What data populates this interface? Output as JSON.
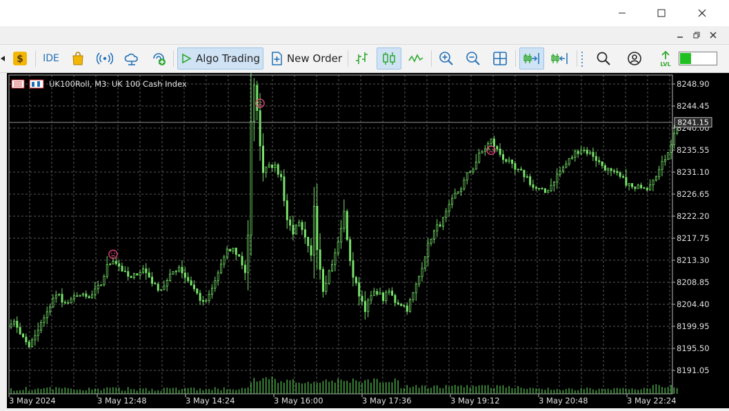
{
  "window": {
    "minimize_icon": "minimize-icon",
    "maximize_icon": "maximize-icon",
    "close_icon": "close-icon"
  },
  "toolbar": {
    "ide_label": "IDE",
    "algo_trading_label": "Algo Trading",
    "new_order_label": "New Order",
    "colors": {
      "active_bg": "#cfe3f5",
      "green": "#2fa82f",
      "blue": "#1f6fb5"
    }
  },
  "chart": {
    "header": "UK100Roll, M3:  UK 100 Cash Index",
    "current_price_label": "8241.15",
    "colors": {
      "background": "#000000",
      "candle": "#78e36b",
      "grid": "#5a5a5a",
      "axis_text": "#e0e0e0",
      "marker": "#e0457b"
    }
  },
  "chart_data": {
    "type": "candlestick",
    "y_ticks": [
      "8248.90",
      "8244.45",
      "8240.00",
      "8235.55",
      "8231.10",
      "8226.65",
      "8222.20",
      "8217.75",
      "8213.30",
      "8208.85",
      "8204.40",
      "8199.95",
      "8195.50",
      "8191.05"
    ],
    "x_ticks": [
      "3 May 2024",
      "3 May 12:48",
      "3 May 14:24",
      "3 May 16:00",
      "3 May 17:36",
      "3 May 19:12",
      "3 May 20:48",
      "3 May 22:24"
    ],
    "ylim": [
      8188.6,
      8251.7
    ],
    "current_price": 8241.15,
    "grid": true,
    "close_path": [
      [
        0,
        8201.0
      ],
      [
        2,
        8200.0
      ],
      [
        4,
        8197.5
      ],
      [
        6,
        8196.0
      ],
      [
        8,
        8197.8
      ],
      [
        10,
        8200.5
      ],
      [
        12,
        8202.5
      ],
      [
        14,
        8205.8
      ],
      [
        16,
        8206.2
      ],
      [
        18,
        8204.5
      ],
      [
        20,
        8205.0
      ],
      [
        22,
        8206.5
      ],
      [
        24,
        8206.0
      ],
      [
        26,
        8205.5
      ],
      [
        28,
        8207.0
      ],
      [
        30,
        8208.5
      ],
      [
        32,
        8212.0
      ],
      [
        34,
        8213.5
      ],
      [
        36,
        8212.2
      ],
      [
        38,
        8210.5
      ],
      [
        40,
        8209.5
      ],
      [
        42,
        8210.8
      ],
      [
        44,
        8211.5
      ],
      [
        46,
        8210.0
      ],
      [
        48,
        8208.0
      ],
      [
        50,
        8207.5
      ],
      [
        52,
        8209.0
      ],
      [
        54,
        8211.0
      ],
      [
        56,
        8212.0
      ],
      [
        58,
        8210.0
      ],
      [
        60,
        8208.5
      ],
      [
        62,
        8206.5
      ],
      [
        64,
        8204.5
      ],
      [
        66,
        8206.0
      ],
      [
        68,
        8209.0
      ],
      [
        70,
        8212.5
      ],
      [
        72,
        8215.0
      ],
      [
        74,
        8215.5
      ],
      [
        76,
        8214.0
      ],
      [
        78,
        8211.0
      ],
      [
        79,
        8218.5
      ],
      [
        80,
        8241.0
      ],
      [
        81,
        8248.2
      ],
      [
        82,
        8244.0
      ],
      [
        83,
        8236.0
      ],
      [
        84,
        8231.5
      ],
      [
        86,
        8233.0
      ],
      [
        88,
        8232.0
      ],
      [
        90,
        8230.0
      ],
      [
        92,
        8221.5
      ],
      [
        94,
        8219.0
      ],
      [
        96,
        8220.5
      ],
      [
        98,
        8217.5
      ],
      [
        100,
        8214.0
      ],
      [
        101,
        8224.5
      ],
      [
        102,
        8216.0
      ],
      [
        104,
        8207.5
      ],
      [
        106,
        8211.0
      ],
      [
        108,
        8214.5
      ],
      [
        110,
        8219.5
      ],
      [
        111,
        8223.5
      ],
      [
        112,
        8217.0
      ],
      [
        114,
        8210.0
      ],
      [
        116,
        8206.5
      ],
      [
        118,
        8203.5
      ],
      [
        120,
        8206.0
      ],
      [
        122,
        8207.0
      ],
      [
        124,
        8205.5
      ],
      [
        126,
        8207.0
      ],
      [
        128,
        8205.0
      ],
      [
        130,
        8204.5
      ],
      [
        132,
        8203.5
      ],
      [
        134,
        8206.5
      ],
      [
        136,
        8210.0
      ],
      [
        138,
        8214.5
      ],
      [
        140,
        8218.0
      ],
      [
        142,
        8220.0
      ],
      [
        144,
        8221.5
      ],
      [
        146,
        8224.0
      ],
      [
        148,
        8226.5
      ],
      [
        150,
        8228.0
      ],
      [
        152,
        8230.5
      ],
      [
        154,
        8232.0
      ],
      [
        156,
        8234.5
      ],
      [
        158,
        8236.0
      ],
      [
        160,
        8237.5
      ],
      [
        162,
        8235.5
      ],
      [
        164,
        8234.0
      ],
      [
        166,
        8233.0
      ],
      [
        168,
        8231.5
      ],
      [
        170,
        8231.0
      ],
      [
        172,
        8230.0
      ],
      [
        174,
        8228.0
      ],
      [
        176,
        8227.5
      ],
      [
        178,
        8227.0
      ],
      [
        180,
        8228.5
      ],
      [
        182,
        8230.5
      ],
      [
        184,
        8232.0
      ],
      [
        186,
        8233.5
      ],
      [
        188,
        8235.0
      ],
      [
        190,
        8235.8
      ],
      [
        192,
        8235.2
      ],
      [
        194,
        8234.5
      ],
      [
        196,
        8233.0
      ],
      [
        198,
        8232.0
      ],
      [
        200,
        8231.0
      ],
      [
        202,
        8230.5
      ],
      [
        204,
        8229.5
      ],
      [
        206,
        8228.5
      ],
      [
        208,
        8227.5
      ],
      [
        210,
        8228.5
      ],
      [
        212,
        8228.0
      ],
      [
        214,
        8230.0
      ],
      [
        216,
        8231.5
      ],
      [
        218,
        8234.0
      ],
      [
        220,
        8237.0
      ],
      [
        222,
        8240.5
      ]
    ],
    "markers": [
      {
        "candle": 34,
        "price": 8214.5
      },
      {
        "candle": 83,
        "price": 8245.0
      },
      {
        "candle": 160,
        "price": 8235.5
      }
    ]
  }
}
